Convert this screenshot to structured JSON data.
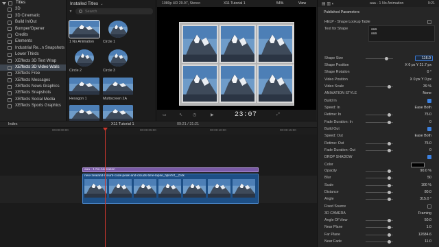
{
  "app": {
    "name": "Final Cut Pro",
    "accent": "#3c81e0",
    "title_clip_color": "#7a5aa6",
    "video_clip_color": "#1d4f86",
    "playhead_color": "#c8372d"
  },
  "sidebar": {
    "root_label": "Titles",
    "items": [
      {
        "label": "3D",
        "selected": false
      },
      {
        "label": "3D Cinematic",
        "selected": false
      },
      {
        "label": "Build In/Out",
        "selected": false
      },
      {
        "label": "Bumper/Opener",
        "selected": false
      },
      {
        "label": "Credits",
        "selected": false
      },
      {
        "label": "Elements",
        "selected": false
      },
      {
        "label": "Industrial Re...n Snapshots",
        "selected": false
      },
      {
        "label": "Lower Thirds",
        "selected": false
      },
      {
        "label": "XEffects 3D Text Wrap",
        "selected": false
      },
      {
        "label": "XEffects 3D Video Walls",
        "selected": true
      },
      {
        "label": "XEffects Free",
        "selected": false
      },
      {
        "label": "XEffects Messages",
        "selected": false
      },
      {
        "label": "XEffects News Graphics",
        "selected": false
      },
      {
        "label": "XEffects Snapshots",
        "selected": false
      },
      {
        "label": "XEffects Social Media",
        "selected": false
      },
      {
        "label": "XEffects Sports Graphics",
        "selected": false
      }
    ]
  },
  "browser": {
    "header_label": "Installed Titles",
    "search_placeholder": "Search",
    "tiles": [
      {
        "label": "1 No Animation",
        "selected": true
      },
      {
        "label": "Circle 1",
        "selected": false
      },
      {
        "label": "Circle 2",
        "selected": false
      },
      {
        "label": "Circle 3",
        "selected": false
      },
      {
        "label": "Hexagon 1",
        "selected": false
      },
      {
        "label": "Multiscreen 2A",
        "selected": false
      },
      {
        "label": "",
        "selected": false
      },
      {
        "label": "",
        "selected": false
      }
    ]
  },
  "viewer": {
    "format": "1080p HD 29.97, Stereo",
    "project": "X11 Tutorial 1",
    "zoom": "54%",
    "view_label": "View",
    "timecode": "23:07"
  },
  "inspector": {
    "clip_title": "aaa - 1 No Animation",
    "time": "9:21",
    "section_header": "Published Parameters",
    "rows": [
      {
        "label": "HELP - Shape Lookup Table",
        "kind": "checkbox",
        "checked": false
      },
      {
        "label": "Text for Shape",
        "kind": "textbox"
      },
      {
        "label": "Shape Size",
        "kind": "field",
        "value": "116.0"
      },
      {
        "label": "Shape Position",
        "kind": "xy",
        "value": "X   0   px   Y   21.7  px"
      },
      {
        "label": "Shape Rotation",
        "kind": "value",
        "value": "0 °"
      },
      {
        "label": "Video Position",
        "kind": "xy",
        "value": "X   0   px   Y   0   px"
      },
      {
        "label": "Video Scale",
        "kind": "slider",
        "value": "39 %"
      },
      {
        "label": "ANIMATION STYLE",
        "kind": "value",
        "value": "None"
      },
      {
        "label": "Build In",
        "kind": "checkbox",
        "checked": true
      },
      {
        "label": "Speed: In",
        "kind": "value",
        "value": "Ease Both"
      },
      {
        "label": "Retime: In",
        "kind": "slider",
        "value": "75.0"
      },
      {
        "label": "Fade Duration: In",
        "kind": "slider",
        "value": "0"
      },
      {
        "label": "Build Out",
        "kind": "checkbox",
        "checked": true
      },
      {
        "label": "Speed: Out",
        "kind": "value",
        "value": "Ease Both"
      },
      {
        "label": "Retime: Out",
        "kind": "slider",
        "value": "75.0"
      },
      {
        "label": "Fade Duration: Out",
        "kind": "slider",
        "value": "0"
      },
      {
        "label": "DROP SHADOW",
        "kind": "checkbox",
        "checked": true
      },
      {
        "label": "Color",
        "kind": "color"
      },
      {
        "label": "Opacity",
        "kind": "slider",
        "value": "90.0 %"
      },
      {
        "label": "Blur",
        "kind": "slider",
        "value": "50"
      },
      {
        "label": "Scale",
        "kind": "slider",
        "value": "100 %"
      },
      {
        "label": "Distance",
        "kind": "slider",
        "value": "80.0"
      },
      {
        "label": "Angle",
        "kind": "slider",
        "value": "315.0 °"
      },
      {
        "label": "Fixed Source",
        "kind": "checkbox",
        "checked": false
      },
      {
        "label": "3D CAMERA",
        "kind": "value",
        "value": "Framing"
      },
      {
        "label": "Angle Of View",
        "kind": "slider",
        "value": "50.0"
      },
      {
        "label": "Near Plane",
        "kind": "slider",
        "value": "1.0"
      },
      {
        "label": "Far Plane",
        "kind": "slider",
        "value": "12684.6"
      },
      {
        "label": "Near Fade",
        "kind": "slider",
        "value": "11.0"
      }
    ]
  },
  "timeline": {
    "index_label": "Index",
    "project": "X11 Tutorial 1",
    "duration": "09:21 / 31:21",
    "ruler_ticks": [
      "00:00:00:00",
      "00:00:05:00",
      "00:00:10:00",
      "00:00:15:00"
    ],
    "title_clip_label": "aaa - 1 No Animation",
    "video_clip_label": "new-zealand-mount-cook-peak-and-clouds-time-lapse_hjlrvtVf__D4k"
  }
}
